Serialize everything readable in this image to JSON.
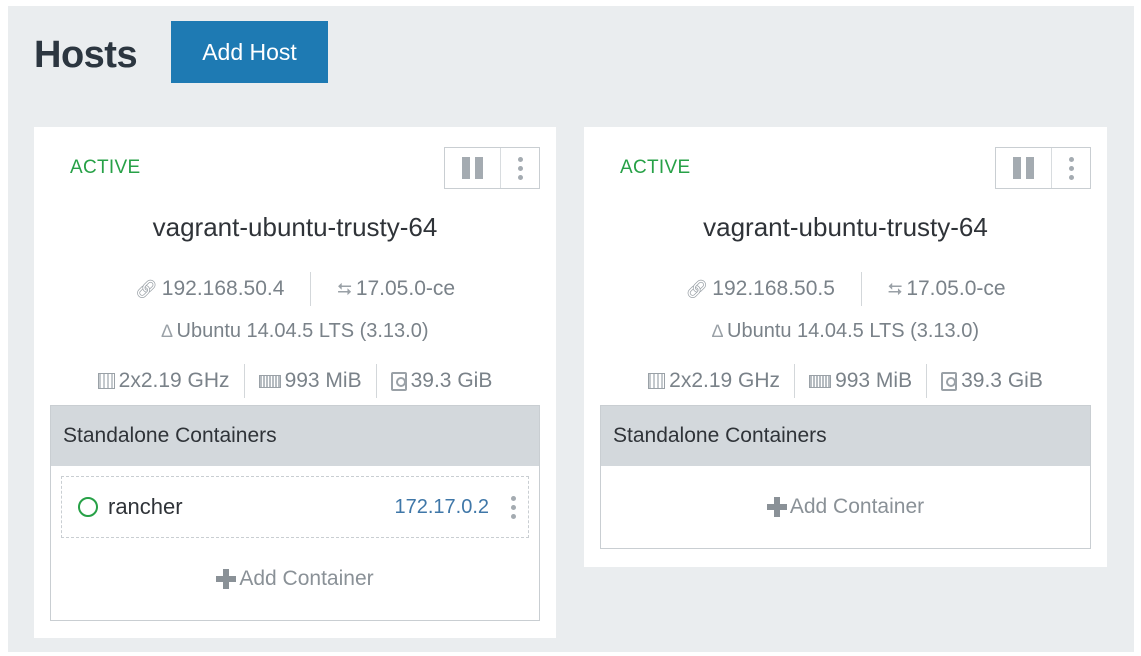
{
  "header": {
    "title": "Hosts",
    "add_host_label": "Add Host"
  },
  "hosts": [
    {
      "state": "ACTIVE",
      "name": "vagrant-ubuntu-trusty-64",
      "ip": "192.168.50.4",
      "docker_version": "17.05.0-ce",
      "os": "Ubuntu 14.04.5 LTS (3.13.0)",
      "cpu": "2x2.19 GHz",
      "memory": "993 MiB",
      "storage": "39.3 GiB",
      "containers_title": "Standalone Containers",
      "containers": [
        {
          "name": "rancher",
          "ip": "172.17.0.2"
        }
      ],
      "add_container_label": "Add Container"
    },
    {
      "state": "ACTIVE",
      "name": "vagrant-ubuntu-trusty-64",
      "ip": "192.168.50.5",
      "docker_version": "17.05.0-ce",
      "os": "Ubuntu 14.04.5 LTS (3.13.0)",
      "cpu": "2x2.19 GHz",
      "memory": "993 MiB",
      "storage": "39.3 GiB",
      "containers_title": "Standalone Containers",
      "containers": [],
      "add_container_label": "Add Container"
    }
  ],
  "colors": {
    "accent": "#1e7ab3",
    "active": "#27a147",
    "link": "#3f77a8",
    "background": "#eaedef"
  },
  "icons": {
    "ip": "link-icon",
    "docker": "docker-icon",
    "os": "linux-icon",
    "cpu": "cpu-icon",
    "memory": "memory-icon",
    "storage": "disk-icon"
  }
}
